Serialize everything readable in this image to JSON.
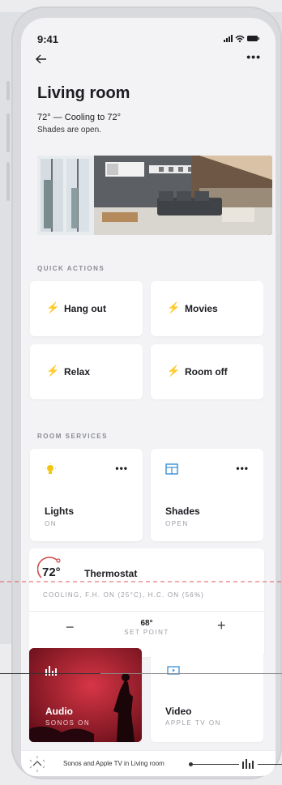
{
  "status_bar": {
    "time": "9:41",
    "icons": "..ıl ᯤ ▬"
  },
  "nav": {
    "back_icon": "arrow-left-icon",
    "more_label": "•••"
  },
  "header": {
    "title": "Living room",
    "summary": "72° — Cooling to 72°",
    "shades_status": "Shades are open."
  },
  "quick_actions": {
    "heading": "QUICK ACTIONS",
    "items": [
      {
        "label": "Hang out"
      },
      {
        "label": "Movies"
      },
      {
        "label": "Relax"
      },
      {
        "label": "Room off"
      }
    ]
  },
  "room_services": {
    "heading": "ROOM SERVICES",
    "items": [
      {
        "name": "Lights",
        "state": "ON",
        "more": "•••",
        "icon": "lightbulb-icon"
      },
      {
        "name": "Shades",
        "state": "OPEN",
        "more": "•••",
        "icon": "shades-icon"
      }
    ]
  },
  "thermostat": {
    "temperature": "72°",
    "title": "Thermostat",
    "details": "COOLING, F.H. ON (25°C), H.C. ON (56%)",
    "minus": "−",
    "plus": "+",
    "set_point_value": "68°",
    "set_point_label": "SET POINT"
  },
  "media": {
    "audio": {
      "name": "Audio",
      "state": "SONOS ON"
    },
    "video": {
      "name": "Video",
      "state": "APPLE TV ON"
    }
  },
  "now_playing": {
    "text": "Sonos and Apple TV in Living room"
  },
  "colors": {
    "accent_yellow": "#f3c612",
    "accent_blue": "#3a8fd6",
    "audio_red": "#b01a2a",
    "dashed_line": "#e05a5a"
  }
}
